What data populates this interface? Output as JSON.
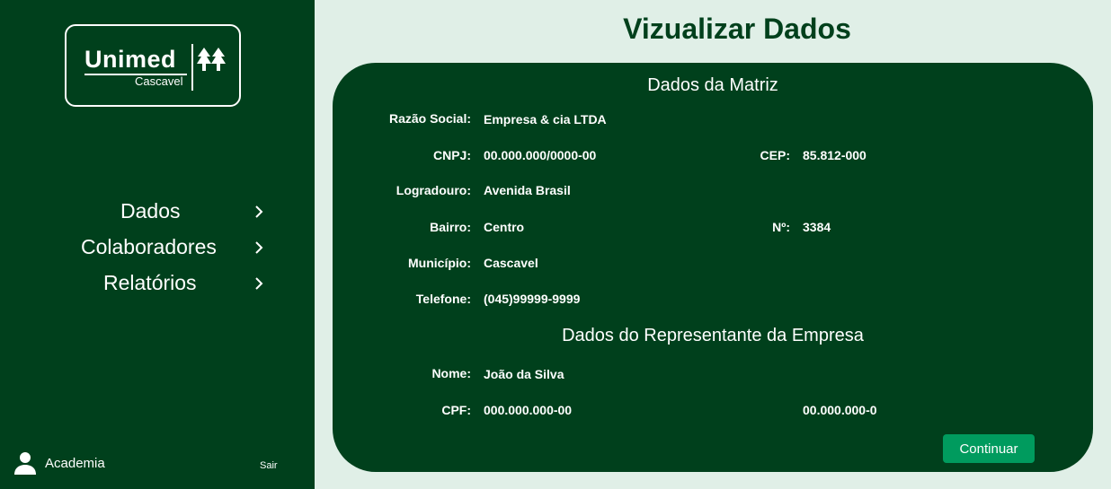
{
  "sidebar": {
    "logo": {
      "word": "Unimed",
      "sub": "Cascavel"
    },
    "nav": [
      {
        "label": "Dados"
      },
      {
        "label": "Colaboradores"
      },
      {
        "label": "Relatórios"
      }
    ],
    "user": {
      "name": "Academia"
    },
    "logout_label": "Sair"
  },
  "main": {
    "title": "Vizualizar Dados",
    "matriz": {
      "title": "Dados da Matriz",
      "razao_social": {
        "label": "Razão Social:",
        "value": "Empresa & cia LTDA"
      },
      "cnpj": {
        "label": "CNPJ:",
        "value": "00.000.000/0000-00"
      },
      "cep": {
        "label": "CEP:",
        "value": "85.812-000"
      },
      "logradouro": {
        "label": "Logradouro:",
        "value": "Avenida Brasil"
      },
      "bairro": {
        "label": "Bairro:",
        "value": "Centro"
      },
      "numero": {
        "label": "Nº:",
        "value": "3384"
      },
      "municipio": {
        "label": "Município:",
        "value": "Cascavel"
      },
      "telefone": {
        "label": "Telefone:",
        "value": "(045)99999-9999"
      }
    },
    "representante": {
      "title": "Dados do Representante da Empresa",
      "nome": {
        "label": "Nome:",
        "value": "João da Silva"
      },
      "cpf": {
        "label": "CPF:",
        "value": "000.000.000-00"
      },
      "extra_value": "00.000.000-0"
    },
    "continue_label": "Continuar"
  },
  "colors": {
    "primary": "#00401c",
    "background": "#e0efe7",
    "button": "#009b5e",
    "text_on_primary": "#ffffff"
  },
  "icons": {
    "user": "user-icon",
    "chevron": "chevron-right-icon",
    "logo_mark": "unimed-logo-icon"
  }
}
